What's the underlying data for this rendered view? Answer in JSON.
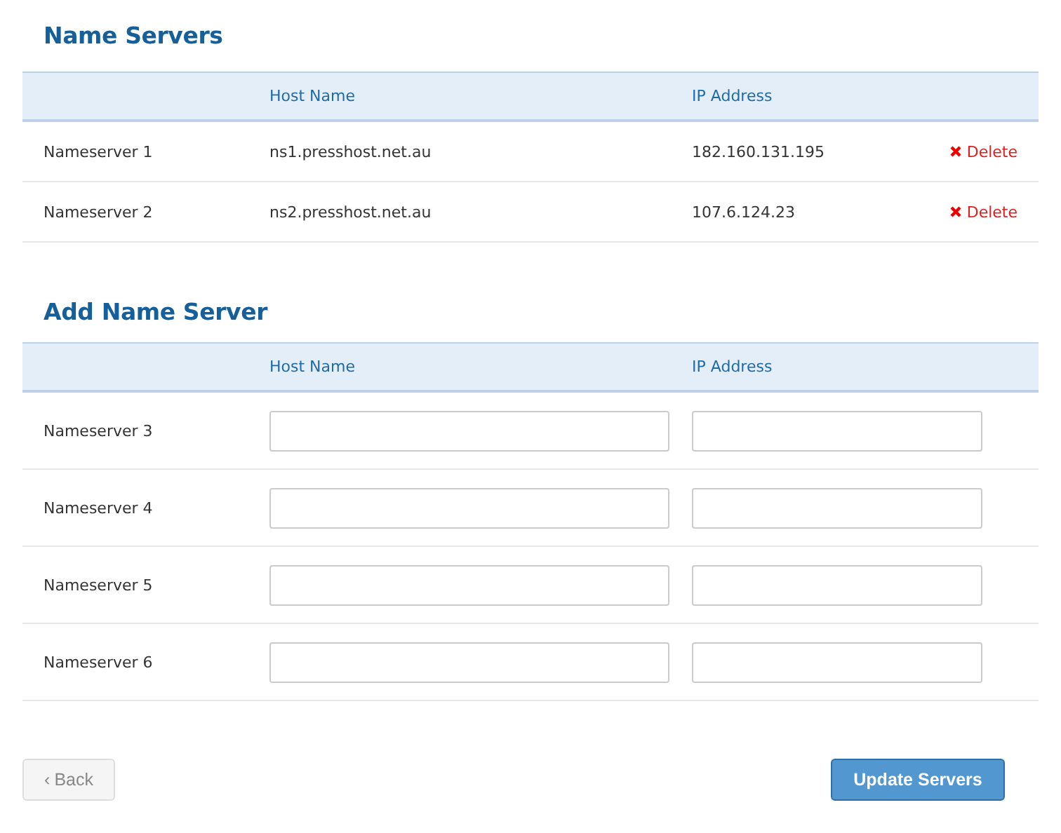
{
  "current": {
    "title": "Name Servers",
    "columns": [
      "Host Name",
      "IP Address"
    ],
    "rows": [
      {
        "label": "Nameserver 1",
        "host": "ns1.presshost.net.au",
        "ip": "182.160.131.195",
        "action": "Delete"
      },
      {
        "label": "Nameserver 2",
        "host": "ns2.presshost.net.au",
        "ip": "107.6.124.23",
        "action": "Delete"
      }
    ]
  },
  "add": {
    "title": "Add Name Server",
    "columns": [
      "Host Name",
      "IP Address"
    ],
    "rows": [
      {
        "label": "Nameserver 3"
      },
      {
        "label": "Nameserver 4"
      },
      {
        "label": "Nameserver 5"
      },
      {
        "label": "Nameserver 6"
      }
    ]
  },
  "buttons": [
    {
      "kind": "back",
      "icon": "‹",
      "label": "Back"
    },
    {
      "kind": "primary",
      "label": "Update Servers"
    }
  ]
}
